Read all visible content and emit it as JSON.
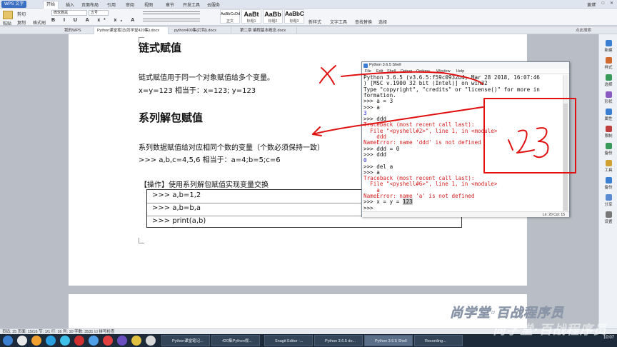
{
  "app": {
    "button": "WPS 文字",
    "menu_tabs": [
      "开始",
      "插入",
      "页面布局",
      "引用",
      "审阅",
      "视图",
      "章节",
      "开发工具",
      "云服务"
    ],
    "user": "黄琪",
    "window_controls": "– □ ✕"
  },
  "ribbon": {
    "paste": "粘贴",
    "cut": "剪切",
    "copy": "复制",
    "format_painter": "格式刷",
    "font_name": "微软雅黑",
    "font_size": "五号",
    "styles": [
      {
        "preview": "AaBbCcDd",
        "name": "正文"
      },
      {
        "preview": "AaBt",
        "name": "标题1"
      },
      {
        "preview": "AaBb",
        "name": "标题2"
      },
      {
        "preview": "AaBbC",
        "name": "标题3"
      }
    ],
    "new_style": "新样式",
    "text_tools": "文字工具",
    "find_replace": "查找替换",
    "select": "选择"
  },
  "doc_tabs": [
    {
      "label": "我的WPS",
      "active": false
    },
    {
      "label": "Python课堂笔记(尚学堂420集).docx",
      "active": true
    },
    {
      "label": "python400集(打钩).docx",
      "active": false
    },
    {
      "label": "第二章 编程基本概念.docx",
      "active": false
    }
  ],
  "doc_tab_search": "点此搜索",
  "document": {
    "heading1": "链式赋值",
    "para1": "链式赋值用于同一个对象赋值给多个变量。",
    "para2": "x=y=123    相当于：x=123; y=123",
    "heading2": "系列解包赋值",
    "para3": "系列数据赋值给对应相同个数的变量（个数必须保持一致）",
    "para4": ">>> a,b,c=4,5,6     相当于：a=4;b=5;c=6",
    "operation_label": "【操作】使用系列解包赋值实现变量交换",
    "code_lines": [
      ">>> a,b=1,2",
      ">>> a,b=b,a",
      ">>> print(a,b)"
    ]
  },
  "shell": {
    "title": "Python 3.6.5 Shell",
    "menu": [
      "File",
      "Edit",
      "Shell",
      "Debug",
      "Options",
      "Window",
      "Help"
    ],
    "lines": [
      {
        "text": "Python 3.6.5 (v3.6.5:f59c0932b4, Mar 28 2018, 16:07:46",
        "cls": "blk"
      },
      {
        "text": ") [MSC v.1900 32 bit (Intel)] on win32",
        "cls": "blk"
      },
      {
        "text": "Type \"copyright\", \"credits\" or \"license()\" for more in",
        "cls": "blk"
      },
      {
        "text": "formation.",
        "cls": "blk"
      },
      {
        "text": ">>> a = 3",
        "cls": "blk"
      },
      {
        "text": ">>> a",
        "cls": "blk"
      },
      {
        "text": "3",
        "cls": "blue"
      },
      {
        "text": ">>> ddd",
        "cls": "blk"
      },
      {
        "text": "Traceback (most recent call last):",
        "cls": "red"
      },
      {
        "text": "  File \"<pyshell#2>\", line 1, in <module>",
        "cls": "red"
      },
      {
        "text": "    ddd",
        "cls": "red"
      },
      {
        "text": "NameError: name 'ddd' is not defined",
        "cls": "red"
      },
      {
        "text": ">>> ddd = 0",
        "cls": "blk"
      },
      {
        "text": ">>> ddd",
        "cls": "blk"
      },
      {
        "text": "0",
        "cls": "blue"
      },
      {
        "text": ">>> del a",
        "cls": "blk"
      },
      {
        "text": ">>> a",
        "cls": "blk"
      },
      {
        "text": "Traceback (most recent call last):",
        "cls": "red"
      },
      {
        "text": "  File \"<pyshell#6>\", line 1, in <module>",
        "cls": "red"
      },
      {
        "text": "    a",
        "cls": "red"
      },
      {
        "text": "NameError: name 'a' is not defined",
        "cls": "red"
      },
      {
        "text": ">>> x = y = ",
        "cls": "blk",
        "selected": "123"
      },
      {
        "text": ">>> ",
        "cls": "blk"
      }
    ],
    "status": "Ln: 20  Col: 15"
  },
  "annotation": {
    "handwritten_text": "123",
    "handwritten_x": "x",
    "stroke_color": "#e01010"
  },
  "right_sidebar": [
    "新建",
    "样式",
    "选择",
    "形状",
    "属性",
    "限制",
    "备份",
    "工具",
    "备份",
    "分享",
    "设置"
  ],
  "status_bar": "页码: 15   页面: 15/16   节: 1/1   行: 16   列: 10   字数: 3531   ☑ 拼写检查",
  "taskbar": {
    "apps": [
      {
        "label": "Python课堂笔记...",
        "active": false
      },
      {
        "label": "420集Python视...",
        "active": false
      },
      {
        "label": "Snagit Editor -...",
        "active": false
      },
      {
        "label": "Python 3.6.5 do...",
        "active": false
      },
      {
        "label": "Python 3.6.5 Shell",
        "active": true
      },
      {
        "label": "Recording...",
        "active": false
      }
    ],
    "clock": "10:07"
  },
  "watermark": "尚学堂·百战程序员"
}
